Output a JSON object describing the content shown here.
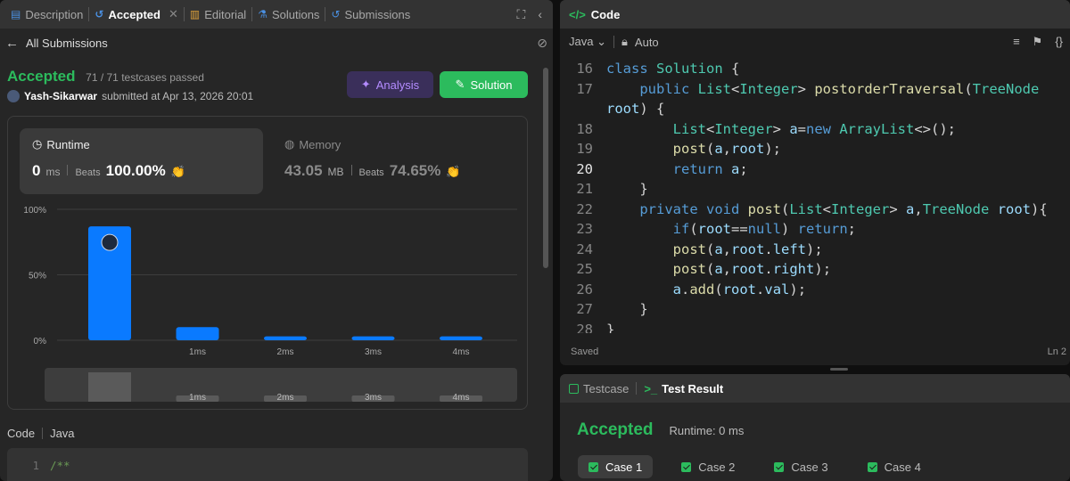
{
  "left_tabs": [
    {
      "label": "Description",
      "icon": "document-icon"
    },
    {
      "label": "Accepted",
      "icon": "history-icon"
    },
    {
      "label": "Editorial",
      "icon": "book-icon"
    },
    {
      "label": "Solutions",
      "icon": "flask-icon"
    },
    {
      "label": "Submissions",
      "icon": "history-icon"
    }
  ],
  "sub_header": {
    "back_label": "All Submissions"
  },
  "submission": {
    "status": "Accepted",
    "testcases": "71 / 71 testcases passed",
    "user": "Yash-Sikarwar",
    "submitted_text": "submitted at Apr 13, 2026 20:01"
  },
  "buttons": {
    "analysis": "Analysis",
    "solution": "Solution"
  },
  "runtime": {
    "label": "Runtime",
    "value": "0",
    "unit": "ms",
    "beats_label": "Beats",
    "beats": "100.00%"
  },
  "memory": {
    "label": "Memory",
    "value": "43.05",
    "unit": "MB",
    "beats_label": "Beats",
    "beats": "74.65%"
  },
  "chart_data": {
    "type": "bar",
    "categories": [
      "0ms",
      "1ms",
      "2ms",
      "3ms",
      "4ms"
    ],
    "tick_labels": [
      "",
      "1ms",
      "2ms",
      "3ms",
      "4ms"
    ],
    "values": [
      87,
      10,
      3,
      3,
      3
    ],
    "yticks": [
      "100%",
      "50%",
      "0%"
    ],
    "ylim": [
      0,
      100
    ],
    "bar_color": "#0a7aff",
    "grid": true,
    "highlight_index": 0
  },
  "code_header": {
    "label": "Code",
    "lang": "Java"
  },
  "code_preview": [
    {
      "n": "1",
      "text": "/**"
    }
  ],
  "editor": {
    "tab_label": "Code",
    "language": "Java",
    "mode": "Auto",
    "saved": "Saved",
    "position": "Ln 2",
    "current_line": 20
  },
  "code_lines": [
    {
      "n": "16",
      "segs": [
        [
          "kw",
          "class "
        ],
        [
          "ty",
          "Solution"
        ],
        [
          "pl",
          " {"
        ]
      ]
    },
    {
      "n": "17",
      "segs": [
        [
          "pl",
          "    "
        ],
        [
          "kw",
          "public "
        ],
        [
          "ty",
          "List"
        ],
        [
          "pl",
          "<"
        ],
        [
          "ty",
          "Integer"
        ],
        [
          "pl",
          "> "
        ],
        [
          "fn",
          "postorderTraversal"
        ],
        [
          "pl",
          "("
        ],
        [
          "ty",
          "TreeNode"
        ]
      ]
    },
    {
      "n": "",
      "segs": [
        [
          "vr",
          "root"
        ],
        [
          "pl",
          ") {"
        ]
      ]
    },
    {
      "n": "18",
      "segs": [
        [
          "pl",
          "        "
        ],
        [
          "ty",
          "List"
        ],
        [
          "pl",
          "<"
        ],
        [
          "ty",
          "Integer"
        ],
        [
          "pl",
          "> "
        ],
        [
          "vr",
          "a"
        ],
        [
          "pl",
          "="
        ],
        [
          "kw",
          "new "
        ],
        [
          "ty",
          "ArrayList"
        ],
        [
          "pl",
          "<>();"
        ]
      ]
    },
    {
      "n": "19",
      "segs": [
        [
          "pl",
          "        "
        ],
        [
          "fn",
          "post"
        ],
        [
          "pl",
          "("
        ],
        [
          "vr",
          "a"
        ],
        [
          "pl",
          ","
        ],
        [
          "vr",
          "root"
        ],
        [
          "pl",
          ");"
        ]
      ]
    },
    {
      "n": "20",
      "segs": [
        [
          "pl",
          "        "
        ],
        [
          "kw",
          "return "
        ],
        [
          "vr",
          "a"
        ],
        [
          "pl",
          ";"
        ]
      ]
    },
    {
      "n": "21",
      "segs": [
        [
          "pl",
          "    }"
        ]
      ]
    },
    {
      "n": "22",
      "segs": [
        [
          "pl",
          "    "
        ],
        [
          "kw",
          "private void "
        ],
        [
          "fn",
          "post"
        ],
        [
          "pl",
          "("
        ],
        [
          "ty",
          "List"
        ],
        [
          "pl",
          "<"
        ],
        [
          "ty",
          "Integer"
        ],
        [
          "pl",
          "> "
        ],
        [
          "vr",
          "a"
        ],
        [
          "pl",
          ","
        ],
        [
          "ty",
          "TreeNode "
        ],
        [
          "vr",
          "root"
        ],
        [
          "pl",
          "){"
        ]
      ]
    },
    {
      "n": "23",
      "segs": [
        [
          "pl",
          "        "
        ],
        [
          "kw",
          "if"
        ],
        [
          "pl",
          "("
        ],
        [
          "vr",
          "root"
        ],
        [
          "pl",
          "=="
        ],
        [
          "kw",
          "null"
        ],
        [
          "pl",
          ") "
        ],
        [
          "kw",
          "return"
        ],
        [
          "pl",
          ";"
        ]
      ]
    },
    {
      "n": "24",
      "segs": [
        [
          "pl",
          "        "
        ],
        [
          "fn",
          "post"
        ],
        [
          "pl",
          "("
        ],
        [
          "vr",
          "a"
        ],
        [
          "pl",
          ","
        ],
        [
          "vr",
          "root"
        ],
        [
          "pl",
          "."
        ],
        [
          "vr",
          "left"
        ],
        [
          "pl",
          ");"
        ]
      ]
    },
    {
      "n": "25",
      "segs": [
        [
          "pl",
          "        "
        ],
        [
          "fn",
          "post"
        ],
        [
          "pl",
          "("
        ],
        [
          "vr",
          "a"
        ],
        [
          "pl",
          ","
        ],
        [
          "vr",
          "root"
        ],
        [
          "pl",
          "."
        ],
        [
          "vr",
          "right"
        ],
        [
          "pl",
          ");"
        ]
      ]
    },
    {
      "n": "26",
      "segs": [
        [
          "pl",
          "        "
        ],
        [
          "vr",
          "a"
        ],
        [
          "pl",
          "."
        ],
        [
          "fn",
          "add"
        ],
        [
          "pl",
          "("
        ],
        [
          "vr",
          "root"
        ],
        [
          "pl",
          "."
        ],
        [
          "vr",
          "val"
        ],
        [
          "pl",
          ");"
        ]
      ]
    },
    {
      "n": "27",
      "segs": [
        [
          "pl",
          "    }"
        ]
      ]
    },
    {
      "n": "28",
      "segs": [
        [
          "pl",
          "}"
        ]
      ]
    }
  ],
  "test_panel": {
    "tab_testcase": "Testcase",
    "tab_result": "Test Result",
    "status": "Accepted",
    "runtime": "Runtime: 0 ms",
    "cases": [
      "Case 1",
      "Case 2",
      "Case 3",
      "Case 4"
    ]
  },
  "colors": {
    "accent_green": "#2cbb5d",
    "bar_blue": "#0a7aff",
    "analysis_purple": "#b48cff"
  }
}
